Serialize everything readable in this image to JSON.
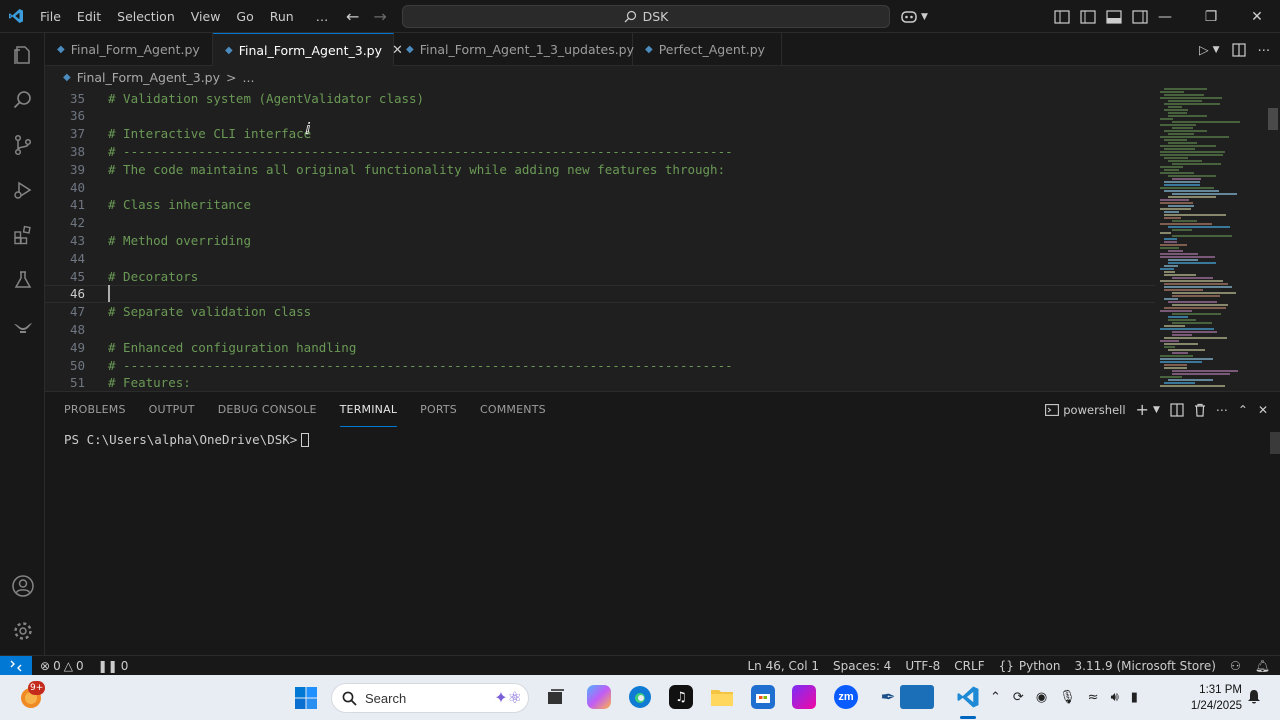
{
  "menu": [
    "File",
    "Edit",
    "Selection",
    "View",
    "Go",
    "Run",
    "…"
  ],
  "search": {
    "label": "DSK"
  },
  "tabs": [
    {
      "label": "Final_Form_Agent.py",
      "active": false
    },
    {
      "label": "Final_Form_Agent_3.py",
      "active": true
    },
    {
      "label": "Final_Form_Agent_1_3_updates.py",
      "active": false
    },
    {
      "label": "Perfect_Agent.py",
      "active": false
    }
  ],
  "breadcrumb": {
    "file": "Final_Form_Agent_3.py",
    "separator": ">",
    "more": "..."
  },
  "editor": {
    "current_line": 46,
    "lines": [
      {
        "n": "35",
        "text": "# Validation system (AgentValidator class)"
      },
      {
        "n": "36",
        "text": ""
      },
      {
        "n": "37",
        "text": "# Interactive CLI interface"
      },
      {
        "n": "38",
        "text": "# ---------------------------------------------------------------------------------"
      },
      {
        "n": "39",
        "text": "# The code maintains all original functionality while adding new features through:"
      },
      {
        "n": "40",
        "text": ""
      },
      {
        "n": "41",
        "text": "# Class inheritance"
      },
      {
        "n": "42",
        "text": ""
      },
      {
        "n": "43",
        "text": "# Method overriding"
      },
      {
        "n": "44",
        "text": ""
      },
      {
        "n": "45",
        "text": "# Decorators"
      },
      {
        "n": "46",
        "text": ""
      },
      {
        "n": "47",
        "text": "# Separate validation class"
      },
      {
        "n": "48",
        "text": ""
      },
      {
        "n": "49",
        "text": "# Enhanced configuration handling"
      },
      {
        "n": "50",
        "text": "# ---------------------------------------------------------------------------------"
      },
      {
        "n": "51",
        "text": "# Features:"
      }
    ]
  },
  "panel": {
    "tabs": [
      "PROBLEMS",
      "OUTPUT",
      "DEBUG CONSOLE",
      "TERMINAL",
      "PORTS",
      "COMMENTS"
    ],
    "active_tab": "TERMINAL",
    "shell": "powershell",
    "terminal_prompt": "PS C:\\Users\\alpha\\OneDrive\\DSK>"
  },
  "status": {
    "errors": "0",
    "warnings": "0",
    "ports": "0",
    "position": "Ln 46, Col 1",
    "spaces": "Spaces: 4",
    "encoding": "UTF-8",
    "eol": "CRLF",
    "language": "Python",
    "interpreter": "3.11.9 (Microsoft Store)"
  },
  "taskbar": {
    "widget_badge": "9+",
    "search_label": "Search",
    "time": "1:31 PM",
    "date": "1/24/2025"
  },
  "colors": {
    "accent": "#0078d4",
    "comment": "#6a9955",
    "editor_bg": "#1f1f1f",
    "chrome_bg": "#181818"
  }
}
